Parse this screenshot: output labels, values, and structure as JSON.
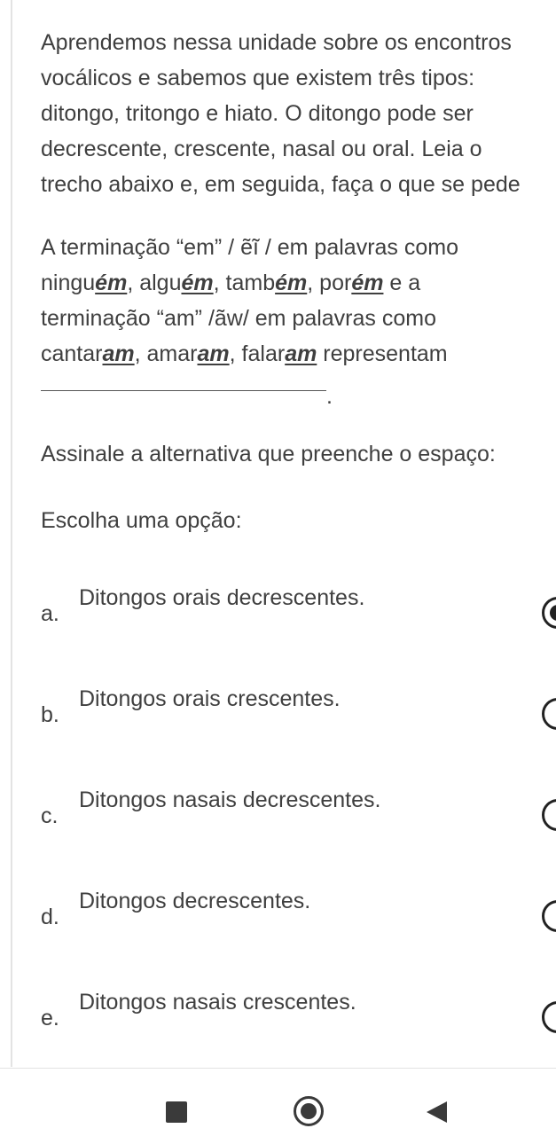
{
  "intro": {
    "lines": [
      "Aprendemos nessa unidade sobre os encontros",
      "vocálicos e sabemos que existem três tipos:",
      "ditongo, tritongo e hiato. O ditongo pode ser",
      "decrescente, crescente, nasal ou oral. Leia o",
      "trecho abaixo e, em seguida, faça o que se pede"
    ]
  },
  "passage": {
    "line1": "A terminação “em” / ẽĩ / em palavras como",
    "line2": {
      "w1_stem": "ningu",
      "w1_end": "ém",
      "sep1": ", ",
      "w2_stem": "algu",
      "w2_end": "ém",
      "sep2": ", ",
      "w3_stem": "tamb",
      "w3_end": "ém",
      "sep3": ", ",
      "w4_stem": "por",
      "w4_end": "ém",
      "tail": " e a"
    },
    "line3": "terminação “am” /ãw/ em palavras como",
    "line4": {
      "w1_stem": "cantar",
      "w1_end": "am",
      "sep1": ", ",
      "w2_stem": "amar",
      "w2_end": "am",
      "sep2": ", ",
      "w3_stem": "falar",
      "w3_end": "am",
      "tail": " representam"
    },
    "blank_end": "."
  },
  "instruction": "Assinale a alternativa que preenche o espaço:",
  "choose_label": "Escolha uma opção:",
  "options": [
    {
      "letter": "a.",
      "text": "Ditongos orais decrescentes.",
      "selected": true
    },
    {
      "letter": "b.",
      "text": "Ditongos orais crescentes.",
      "selected": false
    },
    {
      "letter": "c.",
      "text": "Ditongos nasais decrescentes.",
      "selected": false
    },
    {
      "letter": "d.",
      "text": "Ditongos decrescentes.",
      "selected": false
    },
    {
      "letter": "e.",
      "text": "Ditongos nasais crescentes.",
      "selected": false
    }
  ],
  "navbar": {
    "recent_icon": "square-recent-apps-icon",
    "home_icon": "circle-home-icon",
    "back_icon": "triangle-back-icon"
  },
  "colors": {
    "text": "#3f3f3f",
    "radio": "#222222",
    "nav_icon": "#3a3a3a"
  }
}
